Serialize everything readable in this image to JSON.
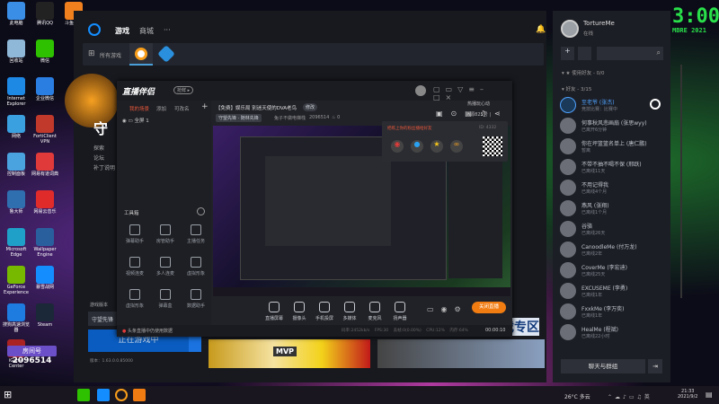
{
  "desktop": {
    "icons": [
      {
        "label": "此电脑",
        "color": "#3a8ee6"
      },
      {
        "label": "腾讯QQ",
        "color": "#222"
      },
      {
        "label": "斗鱼直播",
        "color": "#f0801e"
      },
      {
        "label": "回收站",
        "color": "#8fb8d8"
      },
      {
        "label": "微信",
        "color": "#2dc100"
      },
      {
        "label": "Internet Explorer",
        "color": "#1e88e5"
      },
      {
        "label": "企业微信",
        "color": "#2a7de1"
      },
      {
        "label": "网络",
        "color": "#3aa0e0"
      },
      {
        "label": "FortiClient VPN",
        "color": "#c0392b"
      },
      {
        "label": "控制面板",
        "color": "#4aa3df"
      },
      {
        "label": "网易有道词典",
        "color": "#e03a3a"
      },
      {
        "label": "鲁大师",
        "color": "#2f6fb0"
      },
      {
        "label": "网易云音乐",
        "color": "#e02b2b"
      },
      {
        "label": "Microsoft Edge",
        "color": "#1fa0c8"
      },
      {
        "label": "Wallpaper Engine",
        "color": "#2a5f9e"
      },
      {
        "label": "GeForce Experience",
        "color": "#76b900"
      },
      {
        "label": "暴雪战网",
        "color": "#148eff"
      },
      {
        "label": "搜狗高速浏览器",
        "color": "#1e7be0"
      },
      {
        "label": "Steam",
        "color": "#1b2838"
      },
      {
        "label": "iGame Center",
        "color": "#aa2222"
      }
    ],
    "room_label": "房间号",
    "room_number": "2096514"
  },
  "clock_widget": {
    "time": "3:00",
    "date": "MBRE 2021"
  },
  "battlenet": {
    "nav": [
      "游戏",
      "商城",
      "···"
    ],
    "all_games": "所有游戏",
    "game_title_char": "守",
    "side_links": [
      "探索",
      "论坛",
      "补丁说明"
    ],
    "version_label": "游戏版本",
    "game_select": "守望先锋",
    "play_button": "正在游戏中",
    "version": "版本：1.63.0.0.85000",
    "card1_badge": "MVP",
    "card2_text": "游戏专区"
  },
  "friends": {
    "username": "TortureMe",
    "status": "在线",
    "search_placeholder": "",
    "groups": [
      {
        "label": "使用好友 - 0/0"
      },
      {
        "label": "好友 - 3/15"
      }
    ],
    "list": [
      {
        "name": "至老爷 (张杰)",
        "status": "竞技比赛：比赛中",
        "online": true
      },
      {
        "name": "何事秋风悲画扇 (张思wyy)",
        "status": "已离开6分钟",
        "online": false
      },
      {
        "name": "你在坪篮篮名单上 (唐仁鹏)",
        "status": "暂离",
        "online": false
      },
      {
        "name": "不带不抽不喝不保 (邢跃)",
        "status": "已离线11天",
        "online": false
      },
      {
        "name": "不用记得我",
        "status": "已离线4个月",
        "online": false
      },
      {
        "name": "燕风 (张翔)",
        "status": "已离线1个月",
        "online": false
      },
      {
        "name": "谷骆",
        "status": "已离线26天",
        "online": false
      },
      {
        "name": "CanoodleMe (付万龙)",
        "status": "已离线2年",
        "online": false
      },
      {
        "name": "CoverMe (李宏迪)",
        "status": "已离线25天",
        "online": false
      },
      {
        "name": "EXCUSEME (李勇)",
        "status": "已离线1年",
        "online": false
      },
      {
        "name": "FxxkMe (李万奕)",
        "status": "已离线1年",
        "online": false
      },
      {
        "name": "HealMe (程斌)",
        "status": "已离线22小时",
        "online": false
      }
    ],
    "chat_button": "聊天与群组"
  },
  "stream_tool": {
    "brand": "直播伴侣",
    "beta": "抢鲜 ▸",
    "tabs": [
      "我的场景",
      "添加",
      "可改名"
    ],
    "scene": "全屏 1",
    "title": "【免费】娱乐局 別迷天使的DVA老鸟",
    "tag": "修改",
    "category": "守望先锋 · 随林先锋",
    "streamer": "兔子不做电梯栈",
    "room": "2096514",
    "fans": "0",
    "toolbox_label": "工具箱",
    "tools": [
      "弹幕助手",
      "房管助手",
      "主播任务",
      "视频连麦",
      "多人连麦",
      "虚拟形象",
      "虚拟形象",
      "弹幕盒",
      "数据助手"
    ],
    "share_popup": {
      "title": "把练上你的粉丝播给好友",
      "id": "ID: 4332"
    },
    "bottom_tools": [
      "直播屏幕",
      "摄像头",
      "手机投屏",
      "多媒体",
      "麦克风",
      "扬声器"
    ],
    "close_button": "关闭直播",
    "notice": "头条直播中仍使用数据",
    "stats": [
      "码率:2452kb/s",
      "FPS:30",
      "丢帧:0(0.00%)",
      "CPU:12%",
      "内存:64%"
    ],
    "duration": "00:00:10",
    "right_text": [
      "热播玩心动",
      "6源825号 |"
    ]
  },
  "taskbar": {
    "weather": "26°C 多云",
    "time": "21:33",
    "date": "2021/9/2"
  }
}
